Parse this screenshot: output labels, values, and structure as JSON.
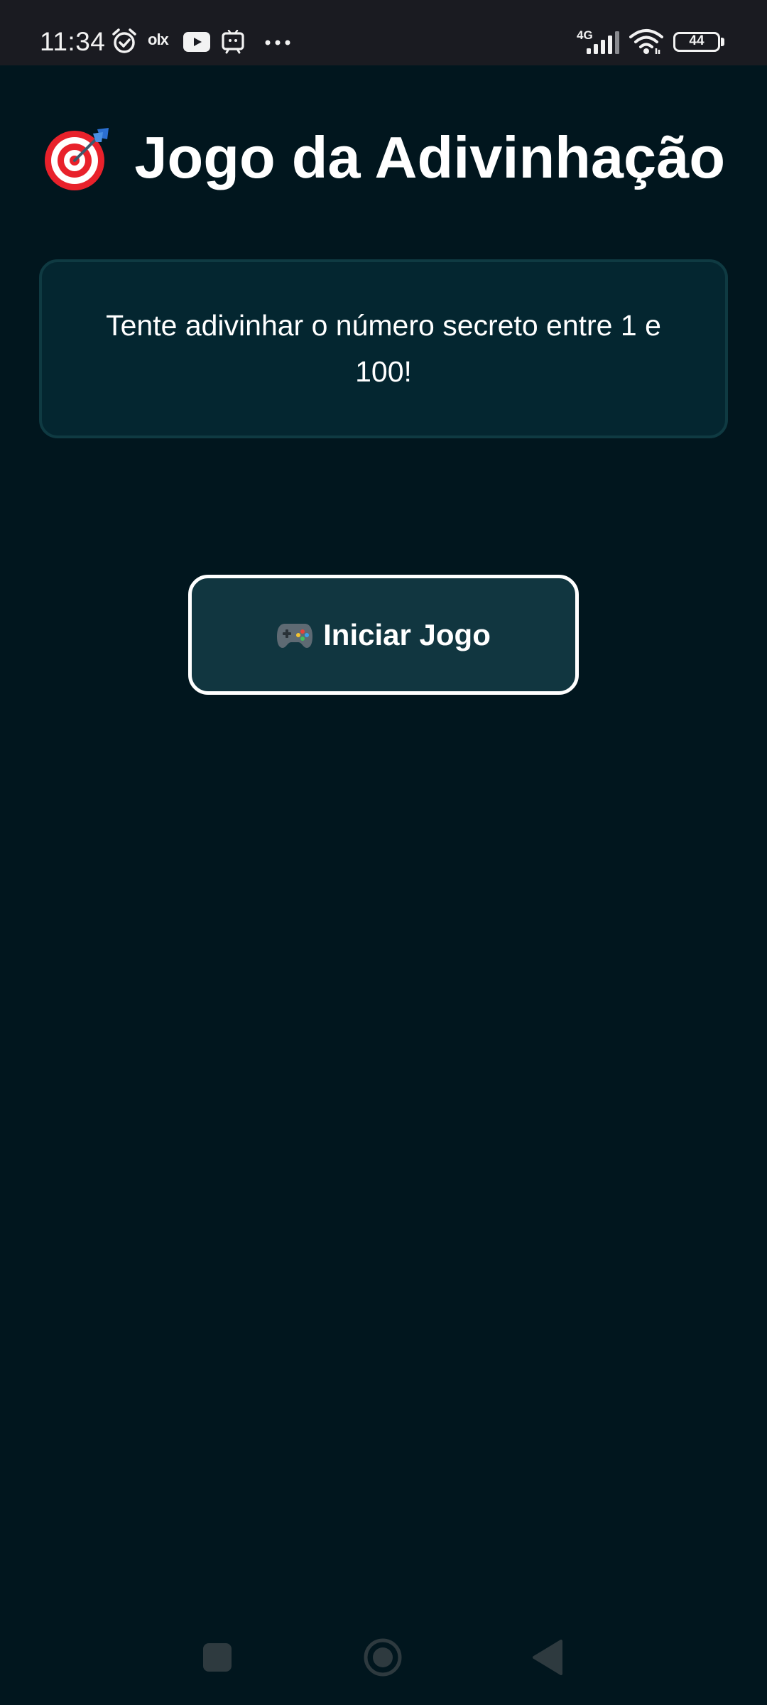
{
  "status_bar": {
    "time": "11:34",
    "network_type": "4G",
    "battery_level": "44",
    "icons": [
      "alarm-icon",
      "olx-icon",
      "youtube-icon",
      "cast-icon",
      "more-icon",
      "signal-icon",
      "wifi-icon",
      "battery-icon"
    ],
    "olx_label": "olx"
  },
  "header": {
    "title": "Jogo da Adivinhação",
    "icon": "target-dart-icon"
  },
  "info_card": {
    "text": "Tente adivinhar o número secreto entre 1 e 100!"
  },
  "start_button": {
    "label": "Iniciar Jogo",
    "icon": "gamepad-icon"
  },
  "nav_bar": {
    "buttons": [
      "recents-button",
      "home-button",
      "back-button"
    ]
  },
  "colors": {
    "background": "#01161e",
    "card_background": "#042630",
    "card_border": "#0f3a42",
    "button_background": "#113640",
    "button_border": "#ffffff",
    "text": "#ffffff",
    "status_bar": "#1a1b21"
  }
}
